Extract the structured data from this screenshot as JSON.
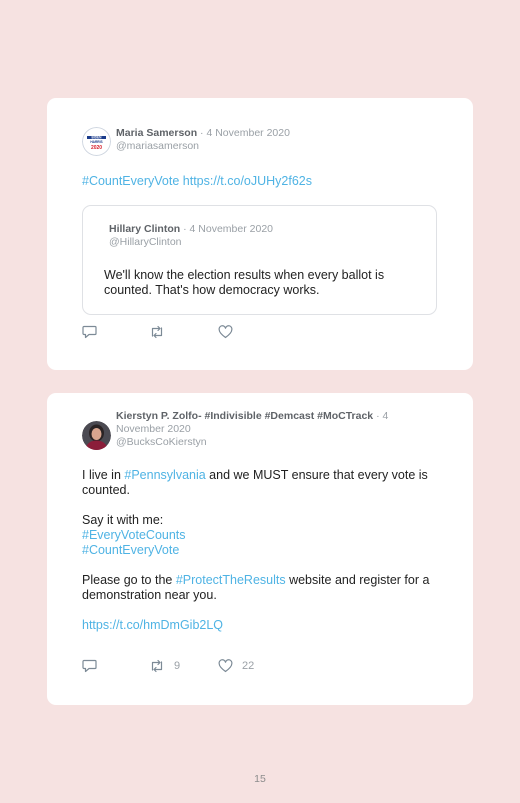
{
  "tweets": [
    {
      "author": "Maria Samerson",
      "separator": "·",
      "date": "4 November 2020",
      "handle": "@mariasamerson",
      "avatar_text": [
        "BIDEN",
        "HARRIS",
        "2020"
      ],
      "hashtag": "#CountEveryVote",
      "link": "https://t.co/oJUHy2f62s",
      "quoted": {
        "author": "Hillary Clinton",
        "separator": "·",
        "date": "4 November 2020",
        "handle": "@HillaryClinton",
        "text": "We'll know the election results when every ballot is counted. That's how democracy works."
      },
      "retweets": "",
      "likes": ""
    },
    {
      "author": "Kierstyn P. Zolfo- #Indivisible #Demcast #MoCTrack",
      "separator": "·",
      "date": "4 November 2020",
      "handle": "@BucksCoKierstyn",
      "line1_pre": "I live in ",
      "line1_tag": "#Pennsylvania",
      "line1_post": " and we MUST ensure that every vote is counted.",
      "say": "Say it with me:",
      "tag1": "#EveryVoteCounts",
      "tag2": "#CountEveryVote",
      "line3_pre": "Please go to the ",
      "line3_tag": "#ProtectTheResults",
      "line3_post": " website and register for a demonstration near you.",
      "link": "https://t.co/hmDmGib2LQ",
      "retweets": "9",
      "likes": "22"
    }
  ],
  "page_number": "15",
  "colors": {
    "link": "#4fb3e4",
    "background": "#f6e2e1",
    "icon": "#7c8a96"
  },
  "icons": [
    "reply-icon",
    "retweet-icon",
    "like-icon"
  ]
}
